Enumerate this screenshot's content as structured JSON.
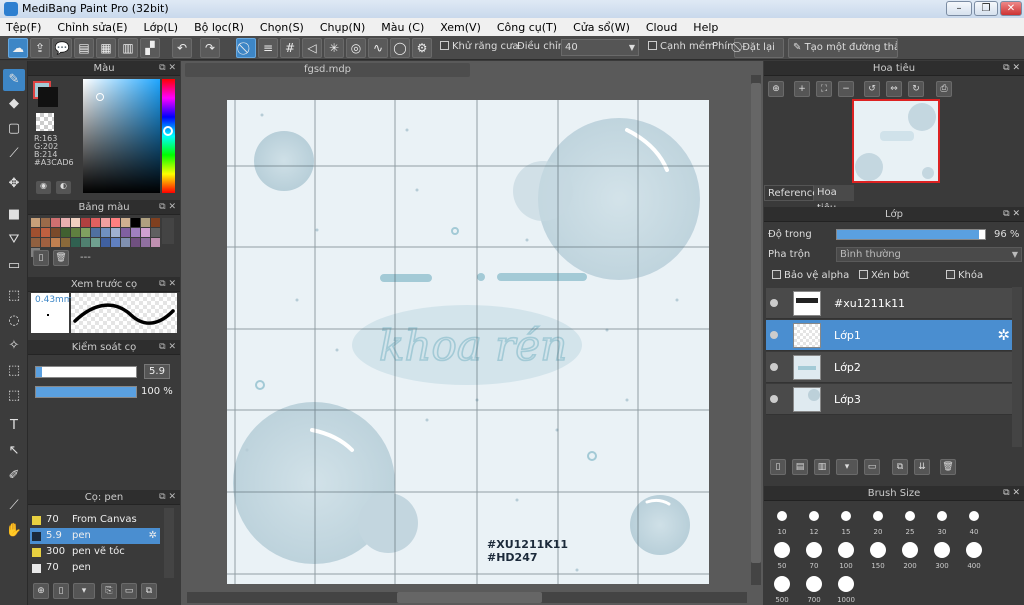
{
  "window": {
    "title": "MediBang Paint Pro (32bit)"
  },
  "menu": [
    "Tệp(F)",
    "Chỉnh sửa(E)",
    "Lớp(L)",
    "Bộ lọc(R)",
    "Chọn(S)",
    "Chụp(N)",
    "Màu (C)",
    "Xem(V)",
    "Công cụ(T)",
    "Cửa sổ(W)",
    "Cloud",
    "Help"
  ],
  "toolbar": {
    "antialias_label": "Khử răng cưa",
    "adjust_label": "Điều chỉnh",
    "adjust_value": "40",
    "soft_edge_label": "Cạnh mềm",
    "key_label": "Phím",
    "reset_label": "Đặt lại",
    "straight_line_label": "Tạo một đường thẳng"
  },
  "color_panel": {
    "title": "Màu",
    "r": "R:163",
    "g": "G:202",
    "b": "B:214",
    "hex": "#A3CAD6",
    "current_color": "#a3cad6"
  },
  "palette_panel": {
    "title": "Bảng màu",
    "extra": "---",
    "colors": [
      "#c8a07a",
      "#9b6b4a",
      "#d07070",
      "#e8b0b0",
      "#f0d0c0",
      "#b04040",
      "#e06060",
      "#f0a0a0",
      "#ff8080",
      "#d0b090",
      "#000000",
      "#b0a080",
      "#804020",
      "#a05030",
      "#c06040",
      "#7a4a2a",
      "#406030",
      "#608040",
      "#80a060",
      "#5070a0",
      "#7090c0",
      "#a0b0d0",
      "#8060a0",
      "#a080c0",
      "#d0a0d0",
      "#606060",
      "#906040",
      "#a06040",
      "#c08050",
      "#8a6a3a",
      "#306050",
      "#508070",
      "#70a090",
      "#4060a0",
      "#6080c0",
      "#8090b0",
      "#705080",
      "#9070a0",
      "#c090b0",
      "#808080"
    ]
  },
  "brush_preview": {
    "title": "Xem trước cọ",
    "size": "0.43mm"
  },
  "brush_control": {
    "title": "Kiểm soát cọ",
    "size_value": "5.9",
    "opacity_value": "100 %",
    "size_fraction": 0.06,
    "opacity_fraction": 1.0
  },
  "brush_list": {
    "title": "Cọ: pen",
    "items": [
      {
        "size": "70",
        "name": "From Canvas",
        "color": "#e8d040"
      },
      {
        "size": "5.9",
        "name": "pen",
        "color": "#1c2a3a"
      },
      {
        "size": "300",
        "name": "pen vẽ tóc",
        "color": "#e8d040"
      },
      {
        "size": "70",
        "name": "pen",
        "color": "#e8e8e8"
      }
    ]
  },
  "document": {
    "tab": "fgsd.mdp",
    "hashtag1": "#XU1211K11",
    "hashtag2": "#HD247",
    "artwork_text": "khoa rén"
  },
  "navigator": {
    "title": "Hoa tiêu",
    "tab_reference": "Reference",
    "tab_navigator": "Hoa tiêu"
  },
  "layers_panel": {
    "title": "Lớp",
    "opacity_label": "Độ trong",
    "opacity_value": "96 %",
    "opacity_fraction": 0.96,
    "blend_label": "Pha trộn",
    "blend_value": "Bình thường",
    "protect_alpha": "Bảo vệ alpha",
    "clipping": "Xén bớt",
    "lock": "Khóa",
    "layers": [
      "#xu1211k11",
      "Lớp1",
      "Lớp2",
      "Lớp3"
    ]
  },
  "brush_size": {
    "title": "Brush Size",
    "row1": [
      "10",
      "12",
      "15",
      "20",
      "25",
      "30",
      "40"
    ],
    "row2": [
      "50",
      "70",
      "100",
      "150",
      "200",
      "300",
      "400"
    ],
    "row3": [
      "500",
      "700",
      "1000"
    ]
  }
}
